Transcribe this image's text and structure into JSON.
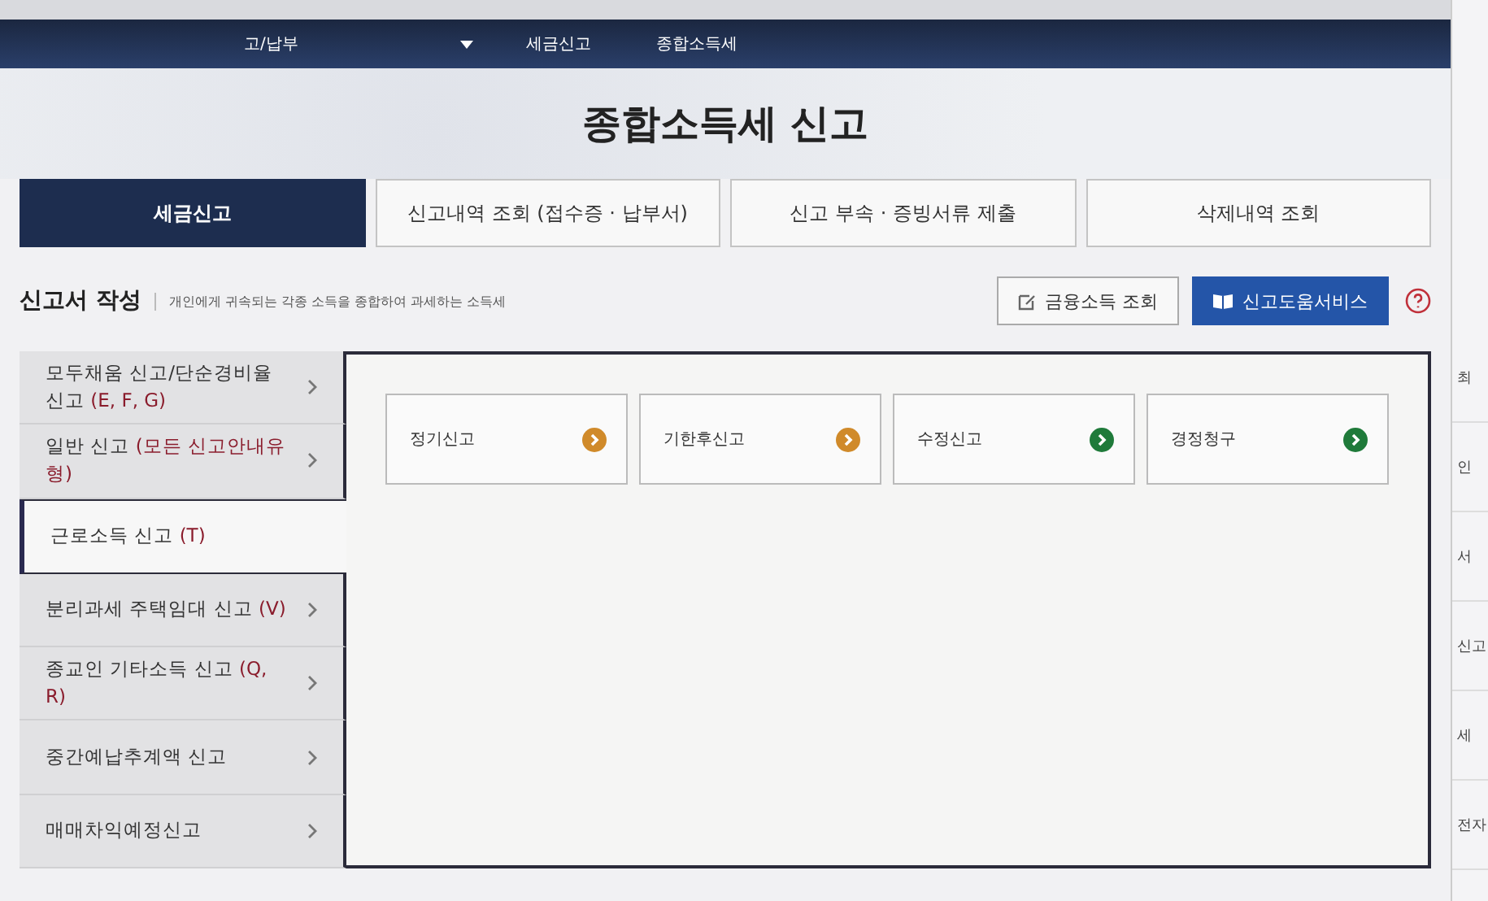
{
  "breadcrumb": [
    {
      "label": "고/납부",
      "dropdown": true
    },
    {
      "label": "세금신고",
      "dropdown": false
    },
    {
      "label": "종합소득세",
      "dropdown": false
    }
  ],
  "page_title": "종합소득세 신고",
  "tabs": [
    {
      "label": "세금신고",
      "selected": true
    },
    {
      "label": "신고내역 조회 (접수증 · 납부서)",
      "selected": false
    },
    {
      "label": "신고 부속 · 증빙서류 제출",
      "selected": false
    },
    {
      "label": "삭제내역 조회",
      "selected": false
    }
  ],
  "section": {
    "title": "신고서 작성",
    "description": "개인에게 귀속되는 각종 소득을 종합하여 과세하는 소득세"
  },
  "buttons": [
    {
      "label": "금융소득 조회",
      "kind": "plain"
    },
    {
      "label": "신고도움서비스",
      "kind": "primary"
    }
  ],
  "sidebar": [
    {
      "label": "모두채움 신고/단순경비율 신고",
      "code": "(E, F, G)",
      "selected": false
    },
    {
      "label": "일반 신고",
      "code": "(모든 신고안내유형)",
      "selected": false
    },
    {
      "label": "근로소득 신고",
      "code": "(T)",
      "selected": true
    },
    {
      "label": "분리과세 주택임대 신고",
      "code": "(V)",
      "selected": false
    },
    {
      "label": "종교인 기타소득 신고",
      "code": "(Q, R)",
      "selected": false
    },
    {
      "label": "중간예납추계액 신고",
      "selected": false
    },
    {
      "label": "매매차익예정신고",
      "selected": false
    }
  ],
  "options": [
    {
      "label": "정기신고",
      "color": "#d08a2a"
    },
    {
      "label": "기한후신고",
      "color": "#d08a2a"
    },
    {
      "label": "수정신고",
      "color": "#1f7a3a"
    },
    {
      "label": "경정청구",
      "color": "#1f7a3a"
    }
  ],
  "right_column": [
    "최",
    "인",
    "서",
    "신고",
    "세",
    "전자"
  ]
}
